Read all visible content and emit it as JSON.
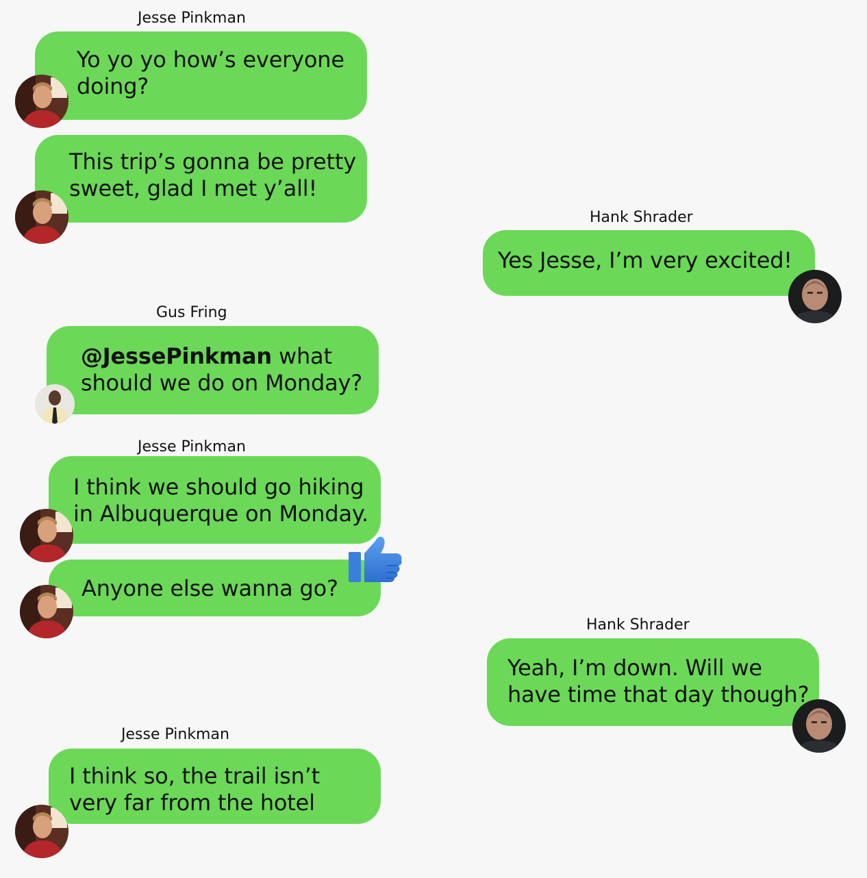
{
  "messages": [
    {
      "sender": "Jesse Pinkman",
      "text": "Yo yo yo how’s everyone doing?"
    },
    {
      "text": "This trip’s gonna be pretty sweet, glad I met y’all!"
    },
    {
      "sender": "Hank Shrader",
      "text": "Yes Jesse, I’m very excited!"
    },
    {
      "sender": "Gus Fring",
      "mention": "@JessePinkman",
      "text": " what should we do on Monday?"
    },
    {
      "sender": "Jesse Pinkman",
      "text": "I think we should go hiking in Albuquerque on Monday."
    },
    {
      "text": "Anyone else wanna go?",
      "reaction": "thumbs-up-icon"
    },
    {
      "sender": "Hank Shrader",
      "text": "Yeah, I’m down. Will we have time that day though?"
    },
    {
      "sender": "Jesse Pinkman",
      "text": "I think so, the trail isn’t very far from the hotel"
    }
  ],
  "colors": {
    "bubble": "#6bd957",
    "background": "#f7f7f7",
    "reaction": "#3b7fdc"
  }
}
